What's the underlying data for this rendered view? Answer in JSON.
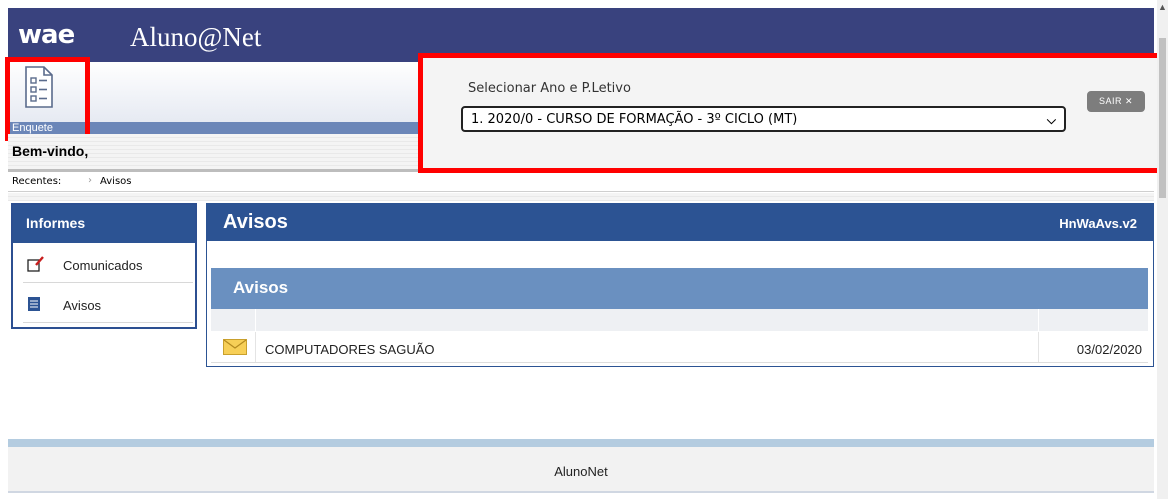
{
  "header": {
    "logo": "wae",
    "title": "Aluno@Net"
  },
  "toolbar": {
    "enquete_label": "Enquete",
    "enquete_icon": "survey-form-icon"
  },
  "period": {
    "label": "Selecionar Ano e P.Letivo",
    "selected": "1. 2020/0 - CURSO DE FORMAÇÃO - 3º CICLO (MT)",
    "logout_label": "SAIR ✕"
  },
  "welcome": "Bem-vindo,",
  "breadcrumb": {
    "label": "Recentes:",
    "items": [
      "Avisos"
    ]
  },
  "sidebar": {
    "title": "Informes",
    "items": [
      {
        "label": "Comunicados",
        "icon": "note-pencil-icon"
      },
      {
        "label": "Avisos",
        "icon": "document-icon"
      }
    ]
  },
  "main": {
    "title": "Avisos",
    "code": "HnWaAvs.v2",
    "list_title": "Avisos",
    "rows": [
      {
        "icon": "envelope-icon",
        "text": "COMPUTADORES SAGUÃO",
        "date": "03/02/2020"
      }
    ]
  },
  "footer": {
    "text": "AlunoNet"
  },
  "colors": {
    "header": "#39427e",
    "panel_blue": "#2c5393",
    "list_head": "#6a90c0",
    "highlight": "#ff0000"
  }
}
